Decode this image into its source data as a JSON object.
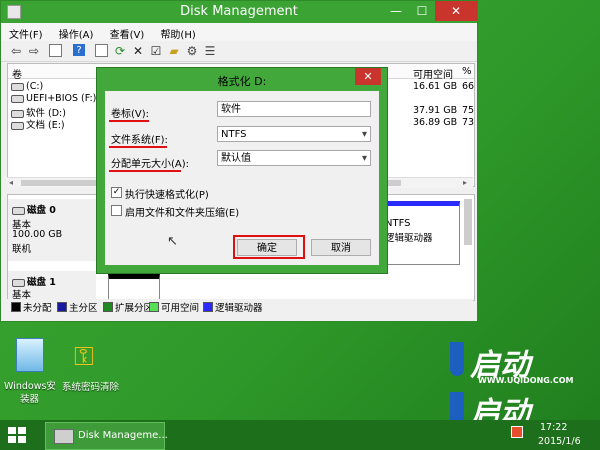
{
  "window": {
    "title": "Disk Management",
    "controls": {
      "minimize": "—",
      "maximize": "☐",
      "close": "✕"
    }
  },
  "menu": [
    "文件(F)",
    "操作(A)",
    "查看(V)",
    "帮助(H)"
  ],
  "volume_list": {
    "columns": {
      "volume": "卷",
      "free": "可用空间",
      "pct": "%"
    },
    "rows": [
      {
        "name": "(C:)",
        "free": "16.61 GB",
        "pct": "66"
      },
      {
        "name": "UEFI+BIOS (F:)",
        "free": "",
        "pct": ""
      },
      {
        "name": "软件 (D:)",
        "free": "37.91 GB",
        "pct": "75"
      },
      {
        "name": "文档 (E:)",
        "free": "36.89 GB",
        "pct": "73"
      }
    ]
  },
  "disks": [
    {
      "name": "磁盘 0",
      "type": "基本",
      "size": "100.00 GB",
      "status": "联机",
      "partition": {
        "fs": "NTFS",
        "desc": "逻辑驱动器"
      }
    },
    {
      "name": "磁盘 1",
      "type": "基本"
    }
  ],
  "legend": [
    {
      "label": "未分配",
      "color": "#000000"
    },
    {
      "label": "主分区",
      "color": "#1a1aa0"
    },
    {
      "label": "扩展分区",
      "color": "#1f8a1f"
    },
    {
      "label": "可用空间",
      "color": "#55e055"
    },
    {
      "label": "逻辑驱动器",
      "color": "#2a2aff"
    }
  ],
  "dialog": {
    "title": "格式化 D:",
    "close": "✕",
    "volume_label": {
      "label": "卷标(V):",
      "value": "软件"
    },
    "file_system": {
      "label": "文件系统(F):",
      "value": "NTFS"
    },
    "alloc_unit": {
      "label": "分配单元大小(A):",
      "value": "默认值"
    },
    "quick_format": {
      "label": "执行快速格式化(P)",
      "checked": true,
      "mark": "✓"
    },
    "compression": {
      "label": "启用文件和文件夹压缩(E)",
      "checked": false
    },
    "ok": "确定",
    "cancel": "取消"
  },
  "desktop": {
    "icons": [
      {
        "label": "Windows安",
        "label2": "装器"
      },
      {
        "label": "系统密码清除"
      }
    ],
    "brand": {
      "text": "启动",
      "site": "WWW.UQIDONG.COM"
    }
  },
  "taskbar": {
    "task": "Disk Manageme...",
    "time": "17:22",
    "date": "2015/1/6"
  },
  "colors": {
    "accent": "#3aa334",
    "highlight": "#e01010"
  }
}
